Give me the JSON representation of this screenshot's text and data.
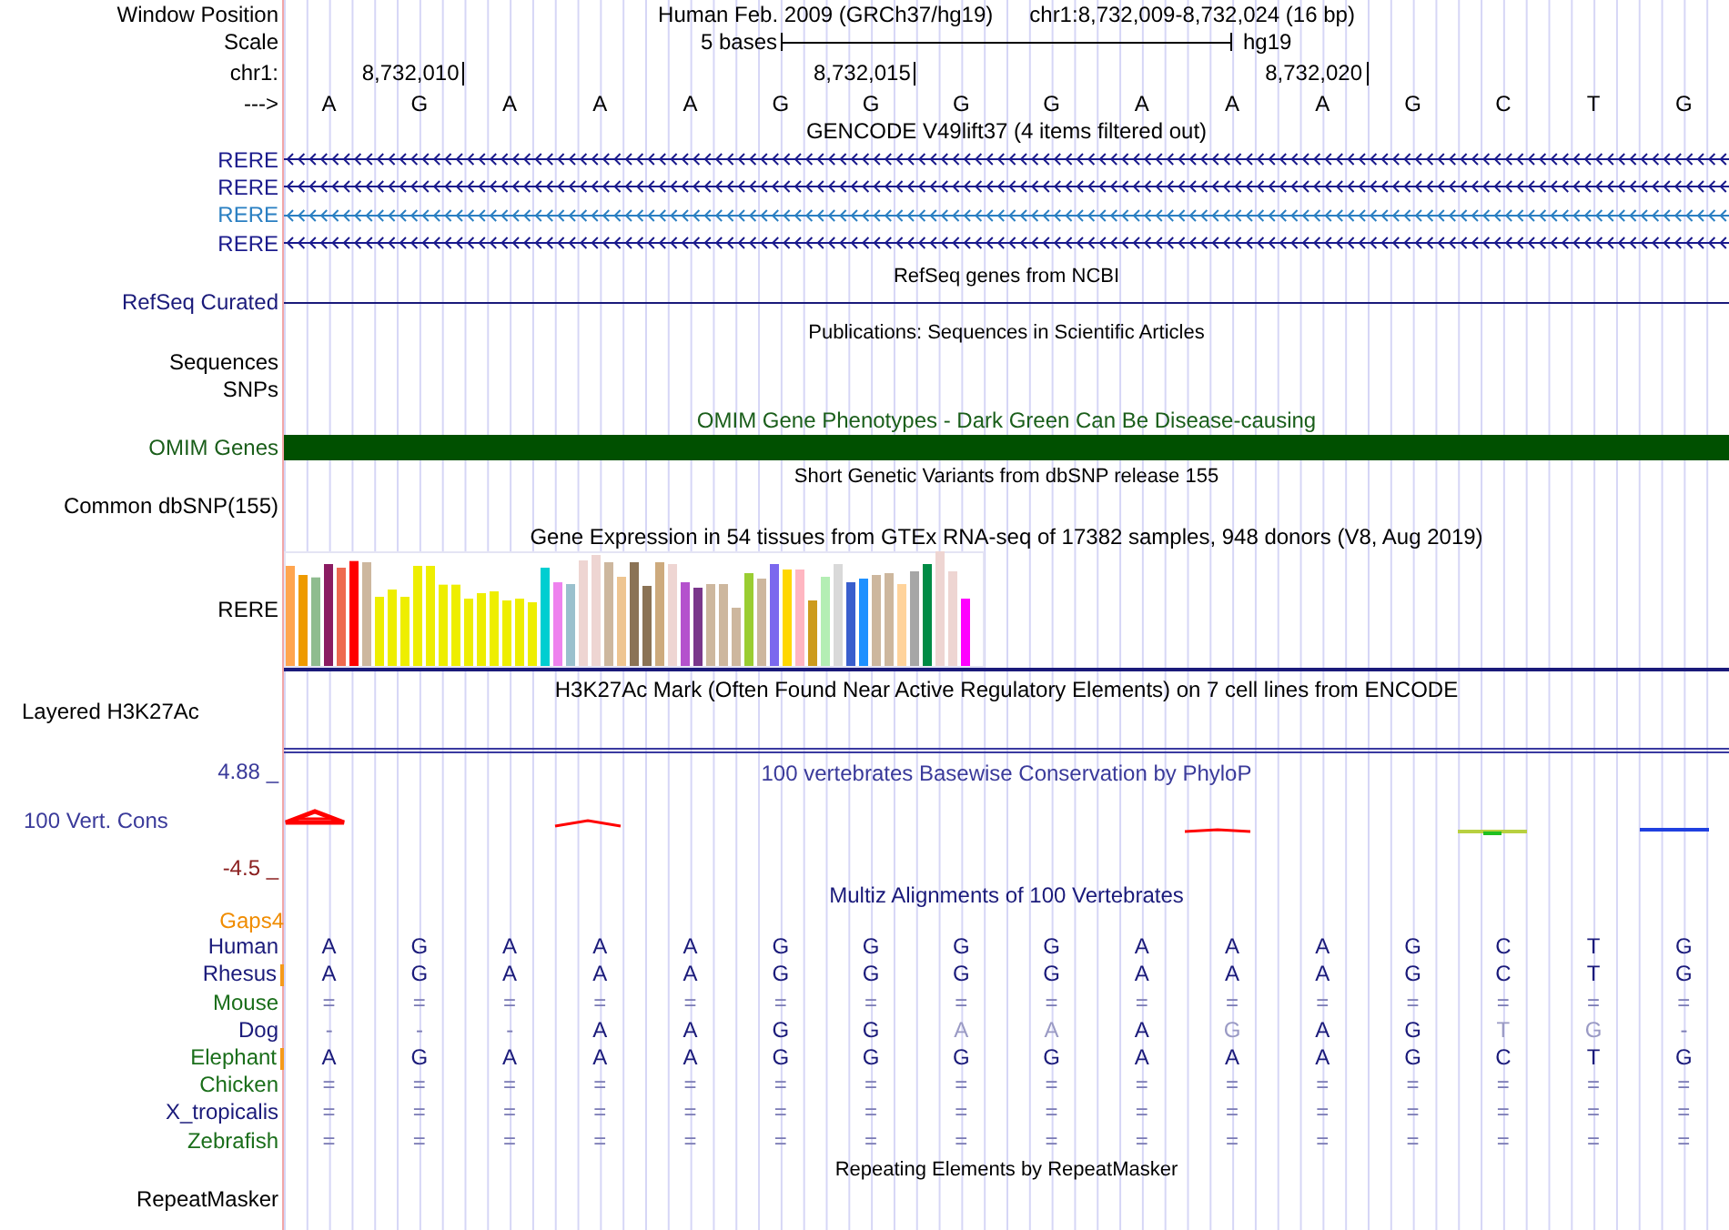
{
  "header": {
    "window_position_label": "Window Position",
    "assembly": "Human Feb. 2009 (GRCh37/hg19)",
    "position": "chr1:8,732,009-8,732,024 (16 bp)",
    "scale_label": "Scale",
    "scale_text": "5 bases",
    "scale_assembly": "hg19",
    "chrom_label": "chr1:",
    "strand_label": "--->",
    "ruler": [
      {
        "base": "A"
      },
      {
        "base": "G",
        "tick": "8,732,010"
      },
      {
        "base": "A"
      },
      {
        "base": "A"
      },
      {
        "base": "A"
      },
      {
        "base": "G"
      },
      {
        "base": "G",
        "tick": "8,732,015"
      },
      {
        "base": "G"
      },
      {
        "base": "G"
      },
      {
        "base": "A"
      },
      {
        "base": "A"
      },
      {
        "base": "A",
        "tick": "8,732,020"
      },
      {
        "base": "G"
      },
      {
        "base": "C"
      },
      {
        "base": "T"
      },
      {
        "base": "G"
      }
    ]
  },
  "tracks": [
    {
      "kind": "genes",
      "title": "GENCODE V49lift37 (4 items filtered out)",
      "items": [
        {
          "label": "RERE",
          "color": "#1a1a8c"
        },
        {
          "label": "RERE",
          "color": "#1a1a8c"
        },
        {
          "label": "RERE",
          "color": "#2a7fc2"
        },
        {
          "label": "RERE",
          "color": "#1a1a8c"
        }
      ]
    },
    {
      "kind": "line",
      "title": "RefSeq genes from NCBI",
      "label": "RefSeq Curated"
    },
    {
      "kind": "empty",
      "title": "Publications: Sequences in Scientific Articles",
      "labels": [
        "Sequences",
        "SNPs"
      ]
    },
    {
      "kind": "bar",
      "title": "OMIM Gene Phenotypes - Dark Green Can Be Disease-causing",
      "label": "OMIM Genes"
    },
    {
      "kind": "empty",
      "title": "Short Genetic Variants from dbSNP release 155",
      "labels": [
        "Common dbSNP(155)"
      ]
    },
    {
      "kind": "expression",
      "title": "Gene Expression in 54 tissues from GTEx RNA-seq of 17382 samples, 948 donors (V8, Aug 2019)",
      "label": "RERE"
    },
    {
      "kind": "signal",
      "title": "H3K27Ac Mark (Often Found Near Active Regulatory Elements) on 7 cell lines from ENCODE",
      "label": "Layered H3K27Ac"
    },
    {
      "kind": "conservation",
      "title": "100 vertebrates Basewise Conservation by PhyloP",
      "label": "100 Vert. Cons",
      "max_label": "4.88 _",
      "min_label": "-4.5 _"
    },
    {
      "kind": "alignment",
      "title": "Multiz Alignments of 100 Vertebrates",
      "gaps_label": "Gaps4",
      "species": [
        {
          "name": "Human",
          "color": "#1a1a7a",
          "gap_mark": false,
          "bases": [
            "A",
            "G",
            "A",
            "A",
            "A",
            "G",
            "G",
            "G",
            "G",
            "A",
            "A",
            "A",
            "G",
            "C",
            "T",
            "G"
          ]
        },
        {
          "name": "Rhesus",
          "color": "#1a1a7a",
          "gap_mark": true,
          "bases": [
            "A",
            "G",
            "A",
            "A",
            "A",
            "G",
            "G",
            "G",
            "G",
            "A",
            "A",
            "A",
            "G",
            "C",
            "T",
            "G"
          ]
        },
        {
          "name": "Mouse",
          "color": "#1a6e1a",
          "gap_mark": false,
          "bases": [
            "=",
            "=",
            "=",
            "=",
            "=",
            "=",
            "=",
            "=",
            "=",
            "=",
            "=",
            "=",
            "=",
            "=",
            "=",
            "="
          ]
        },
        {
          "name": "Dog",
          "color": "#1a1a7a",
          "gap_mark": false,
          "bases": [
            "-",
            "-",
            "-",
            "A",
            "A",
            "G",
            "G",
            "A",
            "A",
            "A",
            "G",
            "A",
            "G",
            "T",
            "G",
            "-"
          ],
          "faded": [
            false,
            false,
            false,
            false,
            false,
            false,
            false,
            true,
            true,
            false,
            true,
            false,
            false,
            true,
            true,
            false
          ]
        },
        {
          "name": "Elephant",
          "color": "#1a6e1a",
          "gap_mark": true,
          "bases": [
            "A",
            "G",
            "A",
            "A",
            "A",
            "G",
            "G",
            "G",
            "G",
            "A",
            "A",
            "A",
            "G",
            "C",
            "T",
            "G"
          ]
        },
        {
          "name": "Chicken",
          "color": "#1a6e1a",
          "gap_mark": false,
          "bases": [
            "=",
            "=",
            "=",
            "=",
            "=",
            "=",
            "=",
            "=",
            "=",
            "=",
            "=",
            "=",
            "=",
            "=",
            "=",
            "="
          ]
        },
        {
          "name": "X_tropicalis",
          "color": "#1a1a7a",
          "gap_mark": false,
          "bases": [
            "=",
            "=",
            "=",
            "=",
            "=",
            "=",
            "=",
            "=",
            "=",
            "=",
            "=",
            "=",
            "=",
            "=",
            "=",
            "="
          ]
        },
        {
          "name": "Zebrafish",
          "color": "#1a6e1a",
          "gap_mark": false,
          "bases": [
            "=",
            "=",
            "=",
            "=",
            "=",
            "=",
            "=",
            "=",
            "=",
            "=",
            "=",
            "=",
            "=",
            "=",
            "=",
            "="
          ]
        }
      ]
    },
    {
      "kind": "empty",
      "title": "Repeating Elements by RepeatMasker",
      "labels": [
        "RepeatMasker"
      ]
    }
  ]
}
